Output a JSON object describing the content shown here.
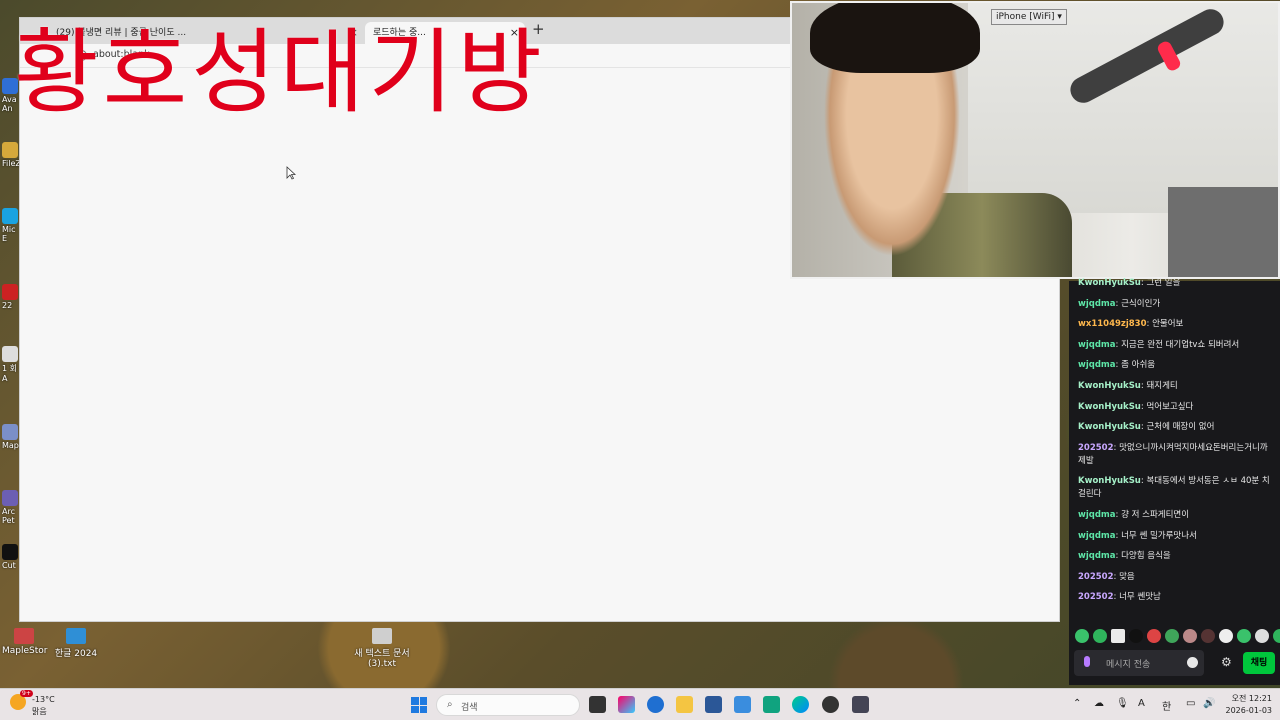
{
  "overlay": {
    "title": "황호성대기방"
  },
  "desktop": {
    "icons_left": [
      "Ava An",
      "FileZ",
      "Mic E",
      "22",
      "1 회A",
      "Map",
      "Arc Pet",
      "Cut"
    ],
    "bottom_icons": [
      "MapleStor",
      "한글 2024",
      "새 텍스트 문서 (3).txt"
    ]
  },
  "browser": {
    "tab_inactive_title": "(29) 불냉면 리뷰 | 중급 난이도 ...",
    "tab_active_title": "로드하는 중...",
    "tab_close": "×",
    "new_tab": "+",
    "address": "about:blank"
  },
  "webcam": {
    "source_label": "iPhone [WiFi]"
  },
  "chat": {
    "messages": [
      {
        "user": "KwonHyukSu",
        "text": "그런 일을",
        "color": "#a5f0c8"
      },
      {
        "user": "wjqdma",
        "text": "근식이인가",
        "color": "#5ee6a8"
      },
      {
        "user": "wx11049zj830",
        "text": "안물어보",
        "color": "#ffb84d"
      },
      {
        "user": "wjqdma",
        "text": "지금은 완전 대기업tv쇼 되버려서",
        "color": "#5ee6a8"
      },
      {
        "user": "wjqdma",
        "text": "좀 아쉬움",
        "color": "#5ee6a8"
      },
      {
        "user": "KwonHyukSu",
        "text": "돼지게티",
        "color": "#a5f0c8"
      },
      {
        "user": "KwonHyukSu",
        "text": "먹어보고싶다",
        "color": "#a5f0c8"
      },
      {
        "user": "KwonHyukSu",
        "text": "근처에 매장이 없어",
        "color": "#a5f0c8"
      },
      {
        "user": "202502",
        "text": "맛없으니까시켜먹지마세요돈버리는거니까제발",
        "color": "#c9a8ff"
      },
      {
        "user": "KwonHyukSu",
        "text": "복대동에서 방서동은 ㅅㅂ 40분 치걸린다",
        "color": "#a5f0c8"
      },
      {
        "user": "wjqdma",
        "text": "걍 저 스파게티면이",
        "color": "#5ee6a8"
      },
      {
        "user": "wjqdma",
        "text": "너무 쎈 밀가루맛나서",
        "color": "#5ee6a8"
      },
      {
        "user": "wjqdma",
        "text": "다양힘 음식을",
        "color": "#5ee6a8"
      },
      {
        "user": "202502",
        "text": "맞음",
        "color": "#c9a8ff"
      },
      {
        "user": "202502",
        "text": "너무 쎈맛남",
        "color": "#c9a8ff"
      }
    ],
    "input_placeholder": "메시지 전송",
    "send_label": "채팅",
    "settings_icon": "gear-icon"
  },
  "taskbar": {
    "weather_temp": "-13°C",
    "weather_cond": "맑음",
    "weather_badge": "9+",
    "search_placeholder": "검색",
    "ime_label": "A",
    "lang_label": "한",
    "clock_time": "오전 12:21",
    "clock_date": "2026-01-03"
  },
  "colors": {
    "overlay_red": "#e0001b",
    "send_green": "#00c73c",
    "chat_bg": "#18181b"
  }
}
